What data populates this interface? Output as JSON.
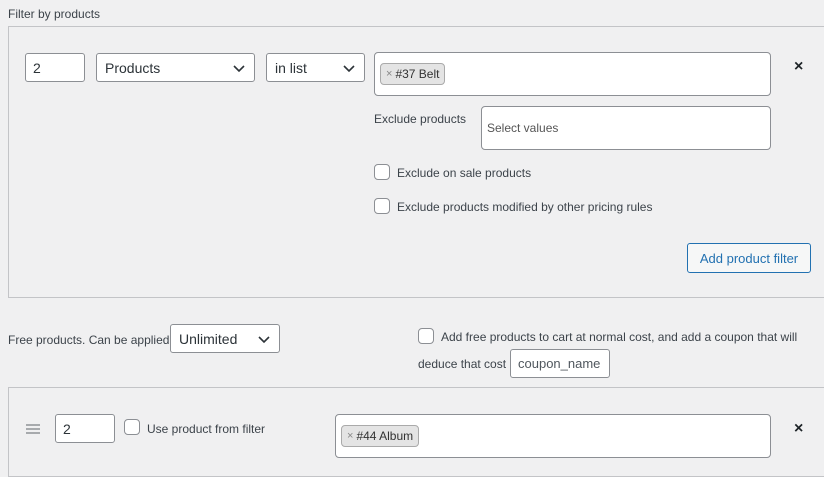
{
  "filter_section": {
    "title": "Filter by products",
    "quantity_value": "2",
    "type_select": "Products",
    "condition_select": "in list",
    "selected_items": [
      {
        "label": "#37 Belt"
      }
    ],
    "exclude_label": "Exclude products",
    "exclude_placeholder": "Select values",
    "exclude_on_sale_label": "Exclude on sale products",
    "exclude_modified_label": "Exclude products modified by other pricing rules",
    "add_button": "Add product filter",
    "remove_icon": "×"
  },
  "free_products": {
    "label": "Free products. Can be applied",
    "limit_select": "Unlimited",
    "normal_cost_label_line1": "Add free products to cart at normal cost, and add a coupon that will",
    "normal_cost_label_line2": "deduce that cost",
    "coupon_value": "coupon_name"
  },
  "free_item_row": {
    "quantity_value": "2",
    "use_from_filter_label": "Use product from filter",
    "selected_items": [
      {
        "label": "#44 Album"
      }
    ],
    "remove_icon": "×"
  },
  "icons": {
    "chip_remove": "×",
    "chevron": "chevron-down-icon",
    "drag": "drag-handle-icon",
    "close": "close-icon"
  }
}
